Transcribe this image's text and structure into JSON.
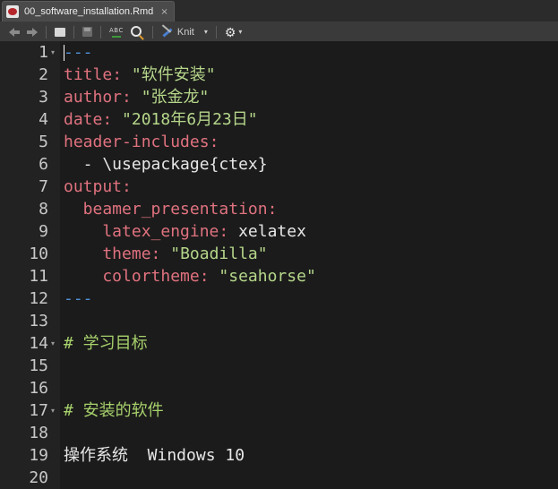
{
  "tab": {
    "label": "00_software_installation.Rmd",
    "close": "×"
  },
  "toolbar": {
    "spell_label": "ABC",
    "knit_label": "Knit",
    "caret": "▾"
  },
  "icons": {
    "file": "rmd-file-icon",
    "back": "arrow-left-icon",
    "forward": "arrow-right-icon",
    "show_in_window": "show-in-window-icon",
    "save": "save-icon",
    "spell": "spellcheck-icon",
    "search": "search-icon",
    "knit": "knit-icon",
    "gear": "gear-icon"
  },
  "colors": {
    "key": "#e0727f",
    "string": "#b5d68a",
    "delimiter": "#4f8fd6",
    "header": "#a7d16b",
    "background": "#1b1b1b"
  },
  "editor": {
    "lines": [
      {
        "num": "1",
        "fold": true,
        "parts": [
          {
            "t": "---",
            "c": "d"
          }
        ]
      },
      {
        "num": "2",
        "fold": false,
        "parts": [
          {
            "t": "title",
            "c": "k"
          },
          {
            "t": ": ",
            "c": "k"
          },
          {
            "t": "\"软件安装\"",
            "c": "s"
          }
        ]
      },
      {
        "num": "3",
        "fold": false,
        "parts": [
          {
            "t": "author",
            "c": "k"
          },
          {
            "t": ": ",
            "c": "k"
          },
          {
            "t": "\"张金龙\"",
            "c": "s"
          }
        ]
      },
      {
        "num": "4",
        "fold": false,
        "parts": [
          {
            "t": "date",
            "c": "k"
          },
          {
            "t": ": ",
            "c": "k"
          },
          {
            "t": "\"2018年6月23日\"",
            "c": "s"
          }
        ]
      },
      {
        "num": "5",
        "fold": false,
        "parts": [
          {
            "t": "header-includes",
            "c": "k"
          },
          {
            "t": ":",
            "c": "k"
          }
        ]
      },
      {
        "num": "6",
        "fold": false,
        "parts": [
          {
            "t": "  - \\usepackage{ctex}",
            "c": "p"
          }
        ]
      },
      {
        "num": "7",
        "fold": false,
        "parts": [
          {
            "t": "output",
            "c": "k"
          },
          {
            "t": ":",
            "c": "k"
          }
        ]
      },
      {
        "num": "8",
        "fold": false,
        "parts": [
          {
            "t": "  beamer_presentation",
            "c": "k"
          },
          {
            "t": ":",
            "c": "k"
          }
        ]
      },
      {
        "num": "9",
        "fold": false,
        "parts": [
          {
            "t": "    latex_engine",
            "c": "k"
          },
          {
            "t": ": ",
            "c": "k"
          },
          {
            "t": "xelatex",
            "c": "p"
          }
        ]
      },
      {
        "num": "10",
        "fold": false,
        "parts": [
          {
            "t": "    theme",
            "c": "k"
          },
          {
            "t": ": ",
            "c": "k"
          },
          {
            "t": "\"Boadilla\"",
            "c": "s"
          }
        ]
      },
      {
        "num": "11",
        "fold": false,
        "parts": [
          {
            "t": "    colortheme",
            "c": "k"
          },
          {
            "t": ": ",
            "c": "k"
          },
          {
            "t": "\"seahorse\"",
            "c": "s"
          }
        ]
      },
      {
        "num": "12",
        "fold": false,
        "parts": [
          {
            "t": "---",
            "c": "d"
          }
        ]
      },
      {
        "num": "13",
        "fold": false,
        "parts": []
      },
      {
        "num": "14",
        "fold": true,
        "parts": [
          {
            "t": "# 学习目标",
            "c": "h"
          }
        ]
      },
      {
        "num": "15",
        "fold": false,
        "parts": []
      },
      {
        "num": "16",
        "fold": false,
        "parts": []
      },
      {
        "num": "17",
        "fold": true,
        "parts": [
          {
            "t": "# 安装的软件",
            "c": "h"
          }
        ]
      },
      {
        "num": "18",
        "fold": false,
        "parts": []
      },
      {
        "num": "19",
        "fold": false,
        "parts": [
          {
            "t": "操作系统  Windows 10",
            "c": "p"
          }
        ]
      },
      {
        "num": "20",
        "fold": false,
        "parts": []
      }
    ]
  }
}
